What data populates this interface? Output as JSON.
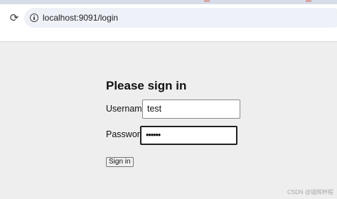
{
  "browser": {
    "url": "localhost:9091/login",
    "reload_icon": "reload-icon",
    "info_icon": "info-icon"
  },
  "login": {
    "heading": "Please sign in",
    "username_label": "Username",
    "username_value": "test",
    "password_label": "Password",
    "password_value": "••••••",
    "submit_label": "Sign in"
  },
  "watermark": "CSDN @镜辉杯程"
}
